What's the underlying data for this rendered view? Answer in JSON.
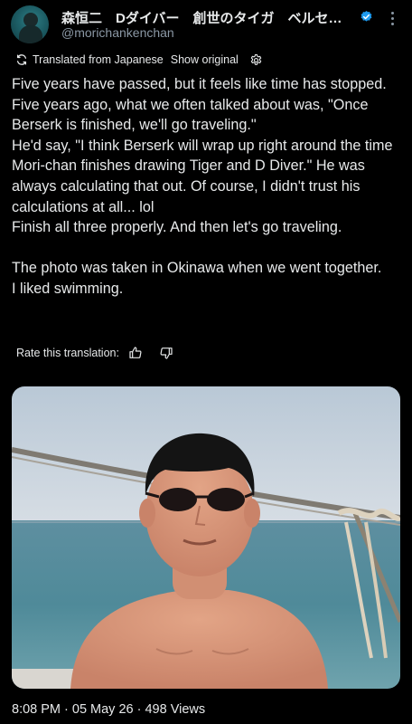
{
  "author": {
    "display_name": "森恒二　Dダイバー　創世のタイガ　ベルセルク…",
    "handle": "@morichankenchan",
    "verified": true,
    "avatar_icon": "user-avatar"
  },
  "translation": {
    "notice": "Translated from Japanese",
    "show_original": "Show original",
    "settings_icon": "gear-icon"
  },
  "tweet": {
    "text": "Five years have passed, but it feels like time has stopped.\nFive years ago, what we often talked about was, \"Once Berserk is finished, we'll go traveling.\"\nHe'd say, \"I think Berserk will wrap up right around the time Mori-chan finishes drawing Tiger and D Diver.\" He was always calculating that out. Of course, I didn't trust his calculations at all... lol\nFinish all three properly. And then let's go traveling.\n\nThe photo was taken in Okinawa when we went together.\nI liked swimming."
  },
  "rate": {
    "label": "Rate this translation:",
    "up_icon": "thumbs-up-icon",
    "down_icon": "thumbs-down-icon"
  },
  "media": {
    "description_icon": "photo"
  },
  "meta": {
    "line": "8:08 PM · 05 May 26 · 498 Views"
  },
  "colors": {
    "background": "#000000",
    "text": "#e7e9ea",
    "secondary": "#8b98a5",
    "verified": "#1d9bf0"
  }
}
